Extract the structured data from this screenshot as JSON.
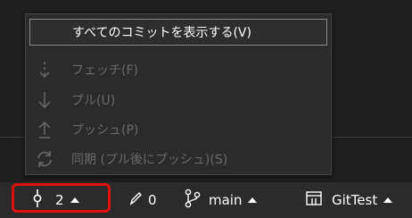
{
  "menu": {
    "items": [
      {
        "label": "すべてのコミットを表示する(V)",
        "enabled": true,
        "icon": "none"
      },
      {
        "label": "フェッチ(F)",
        "enabled": false,
        "icon": "fetch-arrow-down-dashed-icon"
      },
      {
        "label": "プル(U)",
        "enabled": false,
        "icon": "pull-arrow-down-icon"
      },
      {
        "label": "プッシュ(P)",
        "enabled": false,
        "icon": "push-arrow-up-icon"
      },
      {
        "label": "同期 (プル後にプッシュ)(S)",
        "enabled": false,
        "icon": "sync-icon"
      }
    ]
  },
  "statusbar": {
    "commits": {
      "value": "2",
      "icon": "commit-icon"
    },
    "changes": {
      "value": "0",
      "icon": "pencil-icon"
    },
    "branch": {
      "value": "main",
      "icon": "branch-icon"
    },
    "repo": {
      "value": "GitTest",
      "icon": "repository-icon"
    }
  },
  "colors": {
    "background": "#1f1f1f",
    "menu_bg": "#2b2b2b",
    "disabled_text": "#6a6a6a",
    "highlight_box": "#e01010"
  }
}
